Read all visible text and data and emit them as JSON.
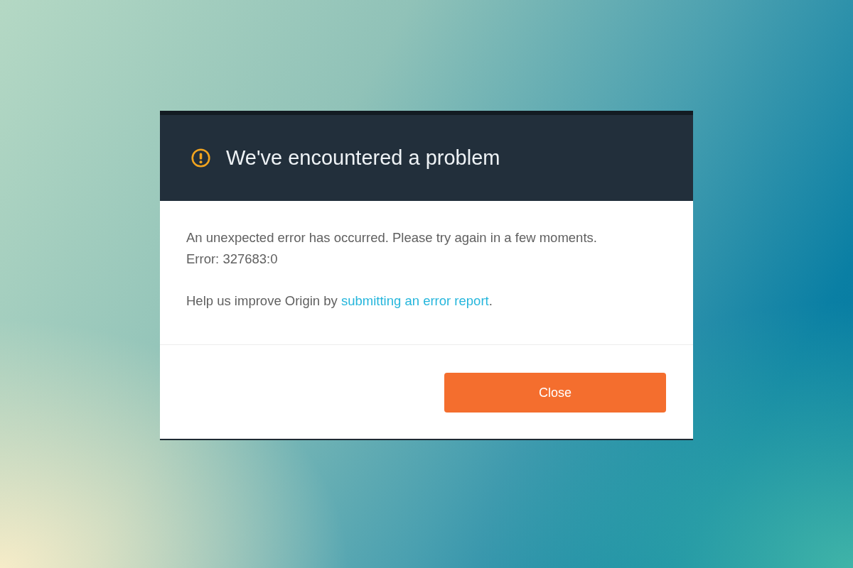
{
  "dialog": {
    "title": "We've encountered a problem",
    "message": "An unexpected error has occurred. Please try again in a few moments.",
    "error_code": "Error: 327683:0",
    "help": {
      "prefix": "Help us improve Origin by",
      "link": "submitting an error report",
      "suffix": "."
    },
    "buttons": [
      {
        "label": "Close",
        "kind": "primary"
      }
    ]
  }
}
